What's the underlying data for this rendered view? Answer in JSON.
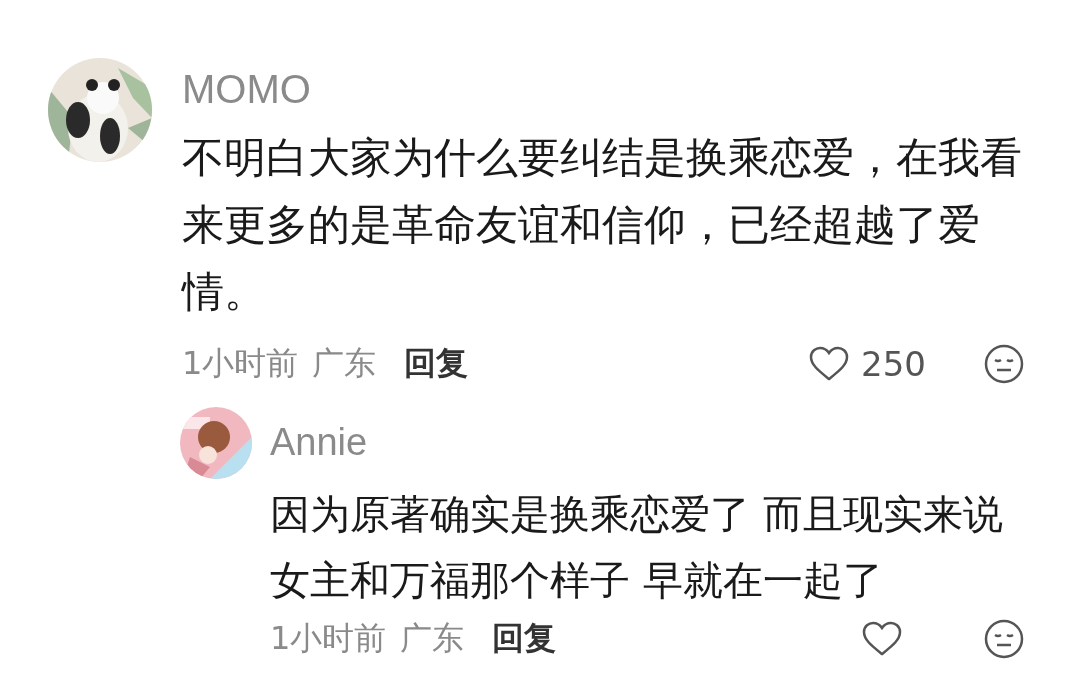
{
  "comments": [
    {
      "user": "MOMO",
      "text": "不明白大家为什么要纠结是换乘恋爱，在我看来更多的是革命友谊和信仰，已经超越了爱情。",
      "time": "1小时前",
      "location": "广东",
      "reply_label": "回复",
      "likes": "250",
      "reply": false
    },
    {
      "user": "Annie",
      "text": "因为原著确实是换乘恋爱了 而且现实来说女主和万福那个样子 早就在一起了",
      "time": "1小时前",
      "location": "广东",
      "reply_label": "回复",
      "reply": true
    }
  ]
}
